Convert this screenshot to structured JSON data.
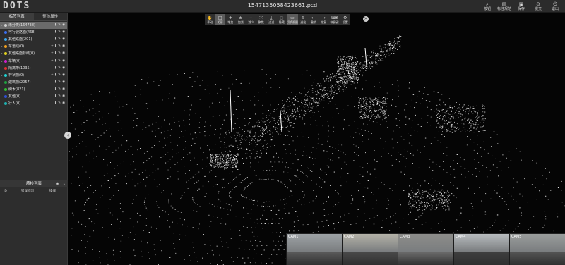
{
  "app": {
    "logo": "DOTS",
    "filename": "1547135058423661.pcd"
  },
  "top_actions": [
    {
      "label": "按钮",
      "icon": "⌕"
    },
    {
      "label": "标注规范",
      "icon": "▤"
    },
    {
      "label": "保存",
      "icon": "▣"
    },
    {
      "label": "提交",
      "icon": "⊙"
    },
    {
      "label": "退出",
      "icon": "⏻"
    }
  ],
  "sidebar": {
    "tabs": [
      {
        "label": "标签列表"
      },
      {
        "label": "整体属性"
      }
    ],
    "labels": [
      {
        "text": "未分类(164738)",
        "color": "#cfcfcf",
        "expand": "▸",
        "selected": true,
        "add": false
      },
      {
        "text": "可行驶路面(468)",
        "color": "#3a6ff0",
        "expand": "",
        "selected": false,
        "add": false
      },
      {
        "text": "其他路面(201)",
        "color": "#3aa9f0",
        "expand": "",
        "selected": false,
        "add": false
      },
      {
        "text": "车道线(0)",
        "color": "#f0a020",
        "expand": "▸",
        "selected": false,
        "add": true
      },
      {
        "text": "其他路面标线(0)",
        "color": "#e0d020",
        "expand": "▸",
        "selected": false,
        "add": true
      },
      {
        "text": "车辆(0)",
        "color": "#d020d0",
        "expand": "▸",
        "selected": false,
        "add": true
      },
      {
        "text": "隔离带(1035)",
        "color": "#e03030",
        "expand": "",
        "selected": false,
        "add": false
      },
      {
        "text": "杆状物(0)",
        "color": "#20d0d0",
        "expand": "▸",
        "selected": false,
        "add": true
      },
      {
        "text": "建筑物(2057)",
        "color": "#20a040",
        "expand": "",
        "selected": false,
        "add": false
      },
      {
        "text": "树木(821)",
        "color": "#30c030",
        "expand": "",
        "selected": false,
        "add": false
      },
      {
        "text": "其他(0)",
        "color": "#3050d0",
        "expand": "",
        "selected": false,
        "add": false
      },
      {
        "text": "行人(0)",
        "color": "#20b0b0",
        "expand": "",
        "selected": false,
        "add": false
      }
    ],
    "qc": {
      "title": "质检列表",
      "columns": [
        "ID",
        "错误原因",
        "操作"
      ]
    }
  },
  "toolbar": [
    {
      "label": "手动",
      "icon": "✋",
      "active": false
    },
    {
      "label": "矩形",
      "icon": "□",
      "active": true
    },
    {
      "label": "增加",
      "icon": "+",
      "active": false
    },
    {
      "label": "加减",
      "icon": "±",
      "active": false
    },
    {
      "label": "减少",
      "icon": "−",
      "active": false
    },
    {
      "label": "聚焦",
      "icon": "⤧",
      "active": false
    },
    {
      "label": "过滤",
      "icon": "⤓",
      "active": false
    },
    {
      "label": "隐藏",
      "icon": "◌",
      "active": false
    },
    {
      "label": "切换视图",
      "icon": "▭",
      "active": true
    },
    {
      "label": "退出",
      "icon": "⇧",
      "active": false
    },
    {
      "label": "撤销",
      "icon": "←",
      "active": false
    },
    {
      "label": "恢复",
      "icon": "→",
      "active": false
    },
    {
      "label": "快捷键",
      "icon": "⌨",
      "active": false
    },
    {
      "label": "设置",
      "icon": "⚙",
      "active": false
    }
  ],
  "cameras": [
    {
      "label": "CAM1",
      "sky": "#9ea3a6",
      "ground": "#5b5b5b"
    },
    {
      "label": "CAM2",
      "sky": "#b4b2a8",
      "ground": "#4a4a4a"
    },
    {
      "label": "CAM3",
      "sky": "#8d8d8a",
      "ground": "#6d6d6d"
    },
    {
      "label": "CAM4",
      "sky": "#b8bcbf",
      "ground": "#3f3f3f"
    },
    {
      "label": "CAM5",
      "sky": "#9a9d9c",
      "ground": "#555555"
    }
  ]
}
